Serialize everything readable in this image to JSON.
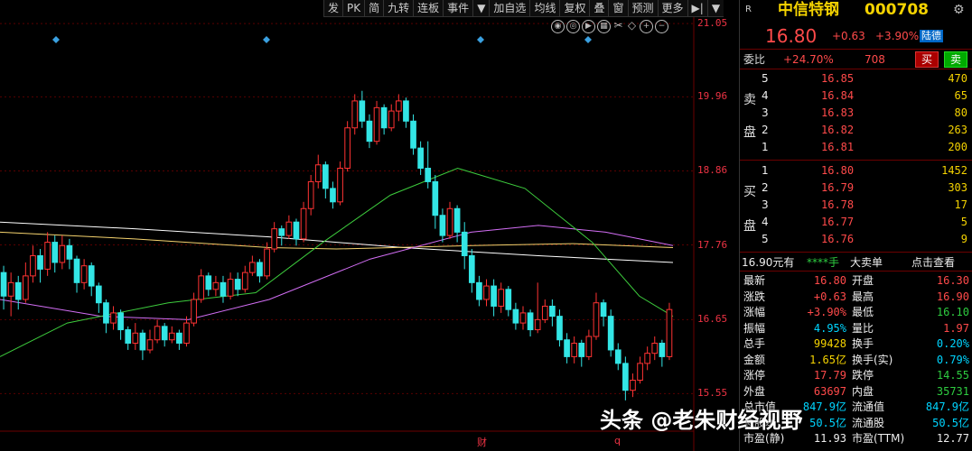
{
  "toolbar": {
    "items": [
      "发",
      "PK",
      "简",
      "九转",
      "连板",
      "事件",
      "▼",
      "加自选",
      "均线",
      "复权",
      "叠",
      "窗",
      "预测",
      "更多",
      "▶|",
      "▼"
    ]
  },
  "chart_icons": [
    "eye-icon",
    "eye-off-icon",
    "play-icon",
    "chart-icon",
    "scissors-icon",
    "arrow-icon",
    "plus-icon",
    "minus-icon"
  ],
  "axis": {
    "y_ticks": [
      "21.05",
      "19.96",
      "18.86",
      "17.76",
      "16.65",
      "15.55"
    ],
    "x_marks": [
      "财",
      "q"
    ]
  },
  "chart_data": {
    "type": "candlestick",
    "ylim": [
      15.1,
      21.4
    ],
    "candles": [
      [
        17.35,
        17.0,
        17.45,
        16.8
      ],
      [
        17.0,
        17.2,
        17.35,
        16.7
      ],
      [
        17.2,
        16.95,
        17.3,
        16.8
      ],
      [
        16.95,
        17.3,
        17.5,
        16.9
      ],
      [
        17.3,
        17.6,
        17.75,
        17.2
      ],
      [
        17.6,
        17.4,
        17.7,
        17.2
      ],
      [
        17.4,
        17.8,
        17.95,
        17.3
      ],
      [
        17.8,
        17.5,
        17.9,
        17.35
      ],
      [
        17.5,
        17.75,
        17.9,
        17.4
      ],
      [
        17.75,
        17.55,
        17.85,
        17.4
      ],
      [
        17.55,
        17.2,
        17.6,
        17.05
      ],
      [
        17.2,
        17.45,
        17.55,
        17.1
      ],
      [
        17.45,
        17.15,
        17.5,
        17.0
      ],
      [
        17.15,
        16.9,
        17.2,
        16.75
      ],
      [
        16.9,
        16.6,
        16.95,
        16.45
      ],
      [
        16.6,
        16.75,
        16.85,
        16.5
      ],
      [
        16.75,
        16.5,
        16.8,
        16.35
      ],
      [
        16.5,
        16.3,
        16.55,
        16.2
      ],
      [
        16.3,
        16.45,
        16.6,
        16.2
      ],
      [
        16.45,
        16.2,
        16.5,
        16.05
      ],
      [
        16.2,
        16.35,
        16.5,
        16.15
      ],
      [
        16.35,
        16.55,
        16.65,
        16.3
      ],
      [
        16.55,
        16.35,
        16.6,
        16.25
      ],
      [
        16.35,
        16.45,
        16.55,
        16.3
      ],
      [
        16.45,
        16.3,
        16.5,
        16.2
      ],
      [
        16.3,
        16.6,
        16.7,
        16.25
      ],
      [
        16.6,
        16.95,
        17.05,
        16.55
      ],
      [
        16.95,
        17.3,
        17.4,
        16.9
      ],
      [
        17.3,
        17.1,
        17.35,
        17.0
      ],
      [
        17.1,
        17.2,
        17.3,
        17.0
      ],
      [
        17.2,
        17.0,
        17.3,
        16.9
      ],
      [
        17.0,
        17.25,
        17.35,
        16.95
      ],
      [
        17.25,
        17.1,
        17.35,
        17.0
      ],
      [
        17.1,
        17.35,
        17.45,
        17.05
      ],
      [
        17.35,
        17.5,
        17.6,
        17.3
      ],
      [
        17.5,
        17.3,
        17.55,
        17.2
      ],
      [
        17.3,
        17.7,
        17.8,
        17.25
      ],
      [
        17.7,
        18.0,
        18.1,
        17.65
      ],
      [
        18.0,
        17.9,
        18.05,
        17.75
      ],
      [
        17.9,
        18.1,
        18.2,
        17.85
      ],
      [
        18.1,
        17.85,
        18.15,
        17.75
      ],
      [
        17.85,
        18.3,
        18.4,
        17.8
      ],
      [
        18.3,
        18.7,
        18.8,
        18.2
      ],
      [
        18.7,
        18.95,
        19.1,
        18.6
      ],
      [
        18.95,
        18.6,
        19.0,
        18.45
      ],
      [
        18.6,
        18.4,
        18.7,
        18.3
      ],
      [
        18.4,
        18.9,
        19.0,
        18.35
      ],
      [
        18.9,
        19.5,
        19.6,
        18.85
      ],
      [
        19.5,
        19.9,
        20.0,
        19.4
      ],
      [
        19.9,
        19.6,
        20.05,
        19.5
      ],
      [
        19.6,
        19.3,
        19.7,
        19.2
      ],
      [
        19.3,
        19.8,
        19.9,
        19.25
      ],
      [
        19.8,
        19.5,
        19.85,
        19.4
      ],
      [
        19.5,
        19.75,
        19.85,
        19.45
      ],
      [
        19.75,
        19.9,
        20.0,
        19.6
      ],
      [
        19.9,
        19.6,
        19.95,
        19.5
      ],
      [
        19.6,
        19.2,
        19.7,
        19.1
      ],
      [
        19.2,
        18.9,
        19.3,
        18.8
      ],
      [
        18.9,
        18.7,
        19.3,
        18.6
      ],
      [
        18.7,
        18.2,
        18.8,
        18.0
      ],
      [
        18.2,
        17.9,
        18.3,
        17.8
      ],
      [
        17.9,
        18.3,
        18.4,
        17.85
      ],
      [
        18.3,
        17.95,
        18.35,
        17.8
      ],
      [
        17.95,
        17.6,
        18.1,
        17.4
      ],
      [
        17.6,
        17.2,
        17.7,
        17.05
      ],
      [
        17.2,
        16.95,
        17.3,
        16.85
      ],
      [
        16.95,
        17.15,
        17.25,
        16.85
      ],
      [
        17.15,
        16.85,
        17.25,
        16.7
      ],
      [
        16.85,
        17.1,
        17.2,
        16.75
      ],
      [
        17.1,
        16.8,
        17.15,
        16.7
      ],
      [
        16.8,
        16.6,
        16.9,
        16.5
      ],
      [
        16.6,
        16.75,
        16.85,
        16.5
      ],
      [
        16.75,
        16.5,
        16.8,
        16.4
      ],
      [
        16.5,
        16.65,
        17.2,
        16.45
      ],
      [
        16.65,
        16.85,
        16.95,
        16.6
      ],
      [
        16.85,
        16.7,
        16.95,
        16.55
      ],
      [
        16.7,
        16.35,
        16.8,
        16.25
      ],
      [
        16.35,
        16.1,
        16.45,
        16.0
      ],
      [
        16.1,
        16.3,
        16.4,
        16.0
      ],
      [
        16.3,
        16.1,
        16.35,
        15.95
      ],
      [
        16.1,
        16.4,
        16.5,
        16.05
      ],
      [
        16.4,
        16.9,
        17.05,
        16.35
      ],
      [
        16.9,
        16.7,
        16.95,
        16.55
      ],
      [
        16.7,
        16.2,
        16.8,
        16.1
      ],
      [
        16.2,
        16.0,
        16.3,
        15.9
      ],
      [
        16.0,
        15.6,
        16.1,
        15.45
      ],
      [
        15.6,
        15.75,
        15.85,
        15.5
      ],
      [
        15.75,
        16.0,
        16.1,
        15.7
      ],
      [
        16.0,
        16.15,
        16.25,
        15.9
      ],
      [
        16.15,
        16.3,
        16.4,
        16.05
      ],
      [
        16.3,
        16.1,
        16.35,
        15.95
      ],
      [
        16.1,
        16.8,
        16.9,
        16.05
      ]
    ],
    "ma_series": [
      {
        "color": "#ffffff",
        "values": [
          [
            0,
            18.1
          ],
          [
            0.2,
            18.0
          ],
          [
            0.4,
            17.88
          ],
          [
            0.6,
            17.72
          ],
          [
            0.8,
            17.6
          ],
          [
            1.0,
            17.5
          ]
        ]
      },
      {
        "color": "#f5d36e",
        "values": [
          [
            0,
            17.95
          ],
          [
            0.2,
            17.85
          ],
          [
            0.4,
            17.72
          ],
          [
            0.5,
            17.7
          ],
          [
            0.7,
            17.75
          ],
          [
            0.85,
            17.78
          ],
          [
            1.0,
            17.72
          ]
        ]
      },
      {
        "color": "#d36ef5",
        "values": [
          [
            0,
            16.95
          ],
          [
            0.15,
            16.7
          ],
          [
            0.28,
            16.65
          ],
          [
            0.4,
            16.95
          ],
          [
            0.55,
            17.55
          ],
          [
            0.7,
            17.95
          ],
          [
            0.8,
            18.05
          ],
          [
            0.9,
            17.95
          ],
          [
            1.0,
            17.75
          ]
        ]
      },
      {
        "color": "#3dcc3d",
        "values": [
          [
            0,
            16.1
          ],
          [
            0.1,
            16.6
          ],
          [
            0.25,
            16.9
          ],
          [
            0.38,
            17.05
          ],
          [
            0.48,
            17.8
          ],
          [
            0.58,
            18.5
          ],
          [
            0.68,
            18.9
          ],
          [
            0.78,
            18.6
          ],
          [
            0.88,
            17.8
          ],
          [
            0.95,
            17.0
          ],
          [
            1.0,
            16.7
          ]
        ]
      }
    ]
  },
  "stock": {
    "r_label": "R",
    "name": "中信特钢",
    "code": "000708",
    "price": "16.80",
    "change": "+0.63",
    "pct": "+3.90%",
    "exchange_tag": "陆德",
    "weibi_label": "委比",
    "weibi_pct": "+24.70%",
    "weibi_val": "708",
    "buy_btn": "买",
    "sell_btn": "卖"
  },
  "order_book": {
    "sell_label_1": "卖",
    "sell_label_2": "盘",
    "buy_label_1": "买",
    "buy_label_2": "盘",
    "sells": [
      {
        "lvl": "5",
        "price": "16.85",
        "vol": "470"
      },
      {
        "lvl": "4",
        "price": "16.84",
        "vol": "65"
      },
      {
        "lvl": "3",
        "price": "16.83",
        "vol": "80"
      },
      {
        "lvl": "2",
        "price": "16.82",
        "vol": "263"
      },
      {
        "lvl": "1",
        "price": "16.81",
        "vol": "200"
      }
    ],
    "buys": [
      {
        "lvl": "1",
        "price": "16.80",
        "vol": "1452"
      },
      {
        "lvl": "2",
        "price": "16.79",
        "vol": "303"
      },
      {
        "lvl": "3",
        "price": "16.78",
        "vol": "17"
      },
      {
        "lvl": "4",
        "price": "16.77",
        "vol": "5"
      },
      {
        "lvl": "5",
        "price": "16.76",
        "vol": "9"
      }
    ]
  },
  "big_order": {
    "price_text": "16.90元有",
    "stars": "****手",
    "label": "大卖单",
    "link": "点击查看"
  },
  "stats": [
    {
      "l1": "最新",
      "v1": "16.80",
      "c1": "red",
      "l2": "开盘",
      "v2": "16.30",
      "c2": "red"
    },
    {
      "l1": "涨跌",
      "v1": "+0.63",
      "c1": "red",
      "l2": "最高",
      "v2": "16.90",
      "c2": "red"
    },
    {
      "l1": "涨幅",
      "v1": "+3.90%",
      "c1": "red",
      "l2": "最低",
      "v2": "16.10",
      "c2": "green"
    },
    {
      "l1": "振幅",
      "v1": "4.95%",
      "c1": "cyan",
      "l2": "量比",
      "v2": "1.97",
      "c2": "red"
    },
    {
      "l1": "总手",
      "v1": "99428",
      "c1": "yellow",
      "l2": "换手",
      "v2": "0.20%",
      "c2": "cyan"
    },
    {
      "l1": "金额",
      "v1": "1.65亿",
      "c1": "yellow",
      "l2": "换手(实)",
      "v2": "0.79%",
      "c2": "cyan"
    },
    {
      "l1": "涨停",
      "v1": "17.79",
      "c1": "red",
      "l2": "跌停",
      "v2": "14.55",
      "c2": "green"
    },
    {
      "l1": "外盘",
      "v1": "63697",
      "c1": "red",
      "l2": "内盘",
      "v2": "35731",
      "c2": "green"
    },
    {
      "l1": "总市值",
      "v1": "847.9亿",
      "c1": "cyan",
      "l2": "流通值",
      "v2": "847.9亿",
      "c2": "cyan"
    },
    {
      "l1": "总股本",
      "v1": "50.5亿",
      "c1": "cyan",
      "l2": "流通股",
      "v2": "50.5亿",
      "c2": "cyan"
    },
    {
      "l1": "市盈(静)",
      "v1": "11.93",
      "c1": "white",
      "l2": "市盈(TTM)",
      "v2": "12.77",
      "c2": "white"
    }
  ],
  "watermark": "头条 @老朱财经视野"
}
